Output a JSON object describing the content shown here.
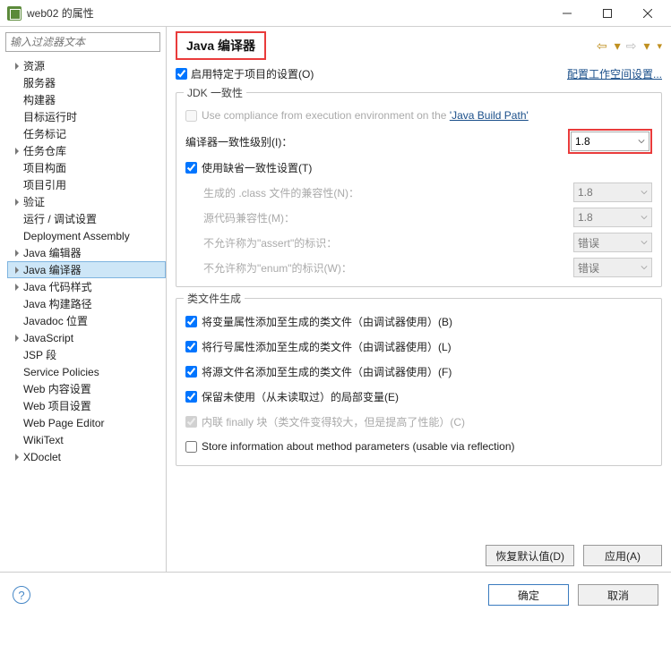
{
  "window": {
    "title": "web02 的属性"
  },
  "filter": {
    "placeholder": "输入过滤器文本"
  },
  "tree": {
    "items": [
      {
        "label": "资源",
        "exp": ">"
      },
      {
        "label": "服务器",
        "exp": ""
      },
      {
        "label": "构建器",
        "exp": ""
      },
      {
        "label": "目标运行时",
        "exp": ""
      },
      {
        "label": "任务标记",
        "exp": ""
      },
      {
        "label": "任务仓库",
        "exp": ">"
      },
      {
        "label": "项目构面",
        "exp": ""
      },
      {
        "label": "项目引用",
        "exp": ""
      },
      {
        "label": "验证",
        "exp": ">"
      },
      {
        "label": "运行 / 调试设置",
        "exp": ""
      },
      {
        "label": "Deployment Assembly",
        "exp": ""
      },
      {
        "label": "Java 编辑器",
        "exp": ">"
      },
      {
        "label": "Java 编译器",
        "exp": ">",
        "selected": true
      },
      {
        "label": "Java 代码样式",
        "exp": ">"
      },
      {
        "label": "Java 构建路径",
        "exp": ""
      },
      {
        "label": "Javadoc 位置",
        "exp": ""
      },
      {
        "label": "JavaScript",
        "exp": ">"
      },
      {
        "label": "JSP 段",
        "exp": ""
      },
      {
        "label": "Service Policies",
        "exp": ""
      },
      {
        "label": "Web 内容设置",
        "exp": ""
      },
      {
        "label": "Web 项目设置",
        "exp": ""
      },
      {
        "label": "Web Page Editor",
        "exp": ""
      },
      {
        "label": "WikiText",
        "exp": ""
      },
      {
        "label": "XDoclet",
        "exp": ">"
      }
    ]
  },
  "panel": {
    "heading": "Java 编译器",
    "enable_specific": "启用特定于项目的设置(O)",
    "workspace_link": "配置工作空间设置...",
    "group1": {
      "legend": "JDK 一致性",
      "use_exec_env_pre": "Use compliance from execution environment on the ",
      "use_exec_env_link": "'Java Build Path'",
      "compiler_level": "编译器一致性级别(I)：",
      "compiler_level_value": "1.8",
      "use_default": "使用缺省一致性设置(T)",
      "class_compat": "生成的 .class 文件的兼容性(N)：",
      "class_compat_value": "1.8",
      "source_compat": "源代码兼容性(M)：",
      "source_compat_value": "1.8",
      "assert_id": "不允许称为\"assert\"的标识：",
      "assert_value": "错误",
      "enum_id": "不允许称为\"enum\"的标识(W)：",
      "enum_value": "错误"
    },
    "group2": {
      "legend": "类文件生成",
      "cb1": "将变量属性添加至生成的类文件（由调试器使用）(B)",
      "cb2": "将行号属性添加至生成的类文件（由调试器使用）(L)",
      "cb3": "将源文件名添加至生成的类文件（由调试器使用）(F)",
      "cb4": "保留未使用（从未读取过）的局部变量(E)",
      "cb5": "内联 finally 块（类文件变得较大，但是提高了性能）(C)",
      "cb6": "Store information about method parameters (usable via reflection)"
    },
    "restore": "恢复默认值(D)",
    "apply": "应用(A)"
  },
  "footer": {
    "ok": "确定",
    "cancel": "取消"
  }
}
